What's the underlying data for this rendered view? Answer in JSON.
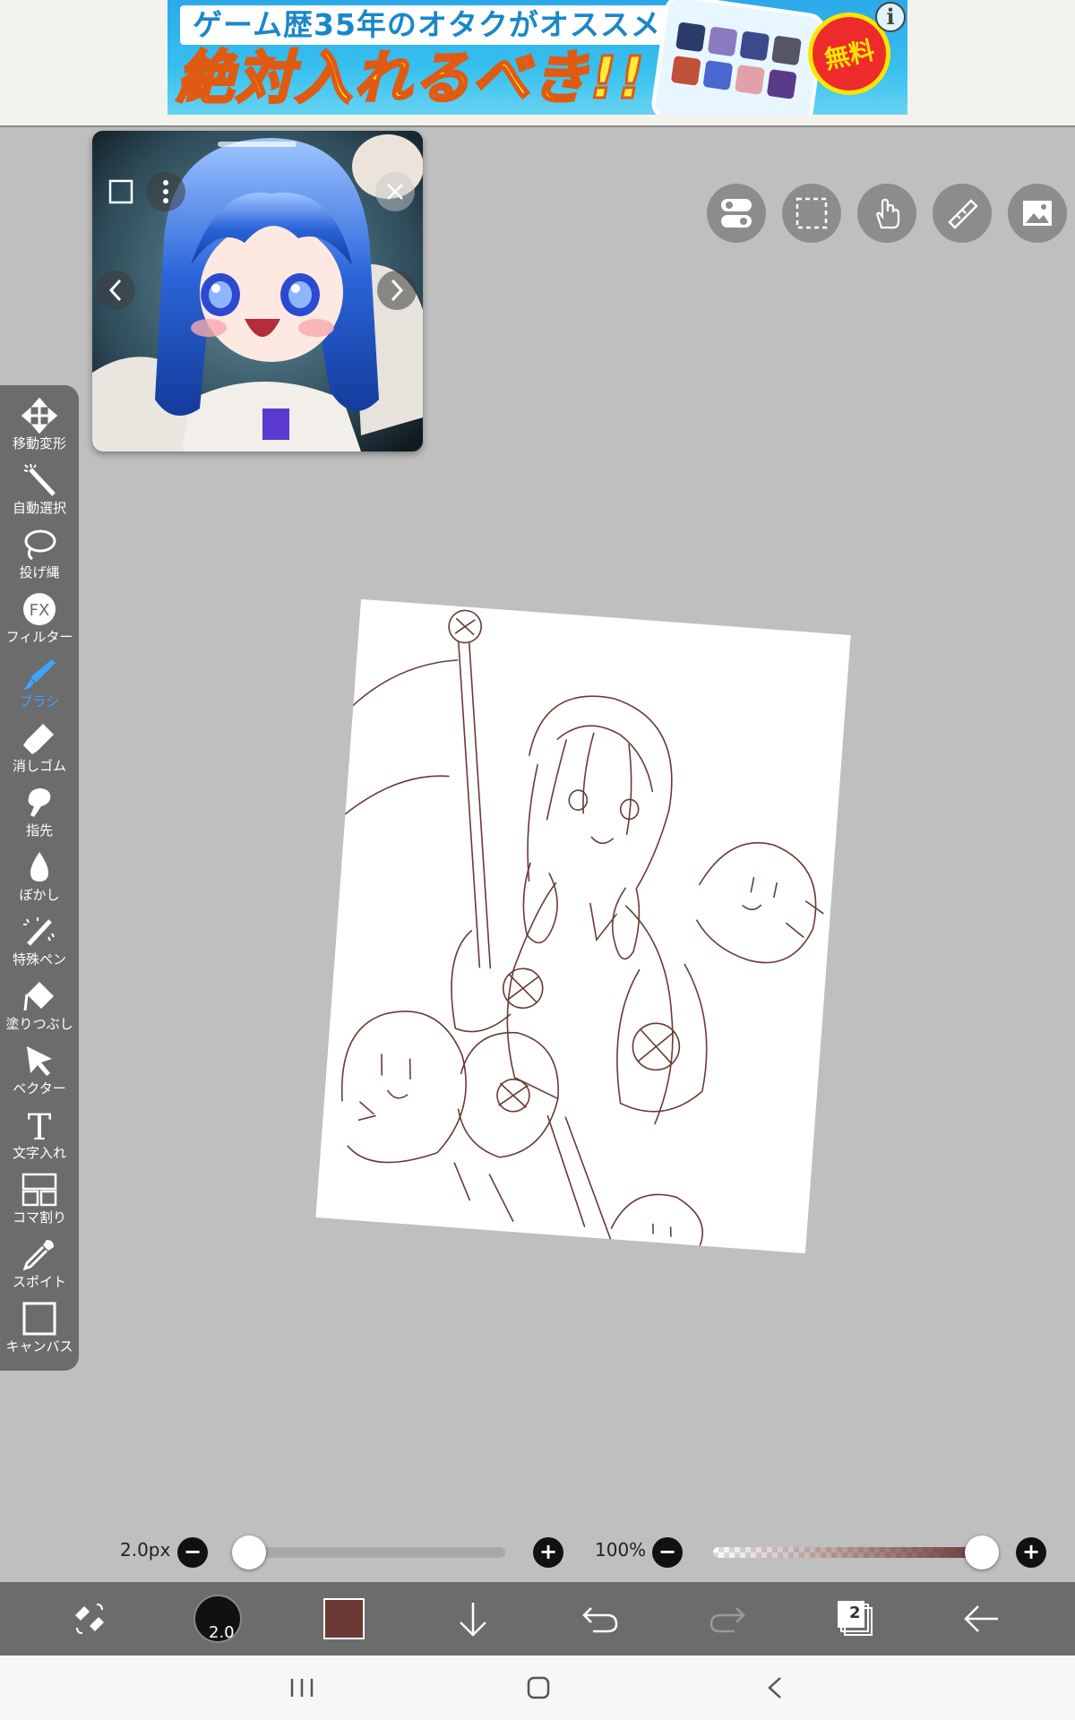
{
  "ad": {
    "line1": "ゲーム歴35年のオタクがオススメ",
    "line2": "絶対入れるべき!!",
    "badge": "無料",
    "info_icon": "info-icon"
  },
  "reference_window": {
    "prev_icon": "chevron-left-icon",
    "next_icon": "chevron-right-icon",
    "more_icon": "more-vert-icon",
    "frame_icon": "square-icon",
    "close_icon": "close-icon"
  },
  "top_tools": [
    {
      "name": "toggle-icon"
    },
    {
      "name": "selection-icon"
    },
    {
      "name": "hand-icon"
    },
    {
      "name": "ruler-icon"
    },
    {
      "name": "image-icon"
    }
  ],
  "tools": [
    {
      "label": "移動変形",
      "icon": "move-icon"
    },
    {
      "label": "自動選択",
      "icon": "magic-wand-icon"
    },
    {
      "label": "投げ縄",
      "icon": "lasso-icon"
    },
    {
      "label": "フィルター",
      "icon": "fx-icon"
    },
    {
      "label": "ブラシ",
      "icon": "brush-icon",
      "active": true
    },
    {
      "label": "消しゴム",
      "icon": "eraser-icon"
    },
    {
      "label": "指先",
      "icon": "finger-icon"
    },
    {
      "label": "ぼかし",
      "icon": "blur-drop-icon"
    },
    {
      "label": "特殊ペン",
      "icon": "special-pen-icon"
    },
    {
      "label": "塗りつぶし",
      "icon": "fill-icon"
    },
    {
      "label": "ベクター",
      "icon": "vector-arrow-icon"
    },
    {
      "label": "文字入れ",
      "icon": "text-icon"
    },
    {
      "label": "コマ割り",
      "icon": "frame-divide-icon"
    },
    {
      "label": "スポイト",
      "icon": "eyedropper-icon"
    },
    {
      "label": "キャンバス",
      "icon": "canvas-icon"
    }
  ],
  "sliders": {
    "brush_size_label": "2.0px",
    "brush_size_fraction": 0.02,
    "opacity_label": "100%",
    "opacity_fraction": 1.0,
    "minus": "−",
    "plus": "+"
  },
  "bottom_bar": {
    "brush_size_value": "2.0",
    "current_color": "#6b3a34",
    "layer_count": "2"
  },
  "colors": {
    "accent": "#3da4ff",
    "panel": "#6c6c6c",
    "workspace": "#bfbfbf"
  }
}
